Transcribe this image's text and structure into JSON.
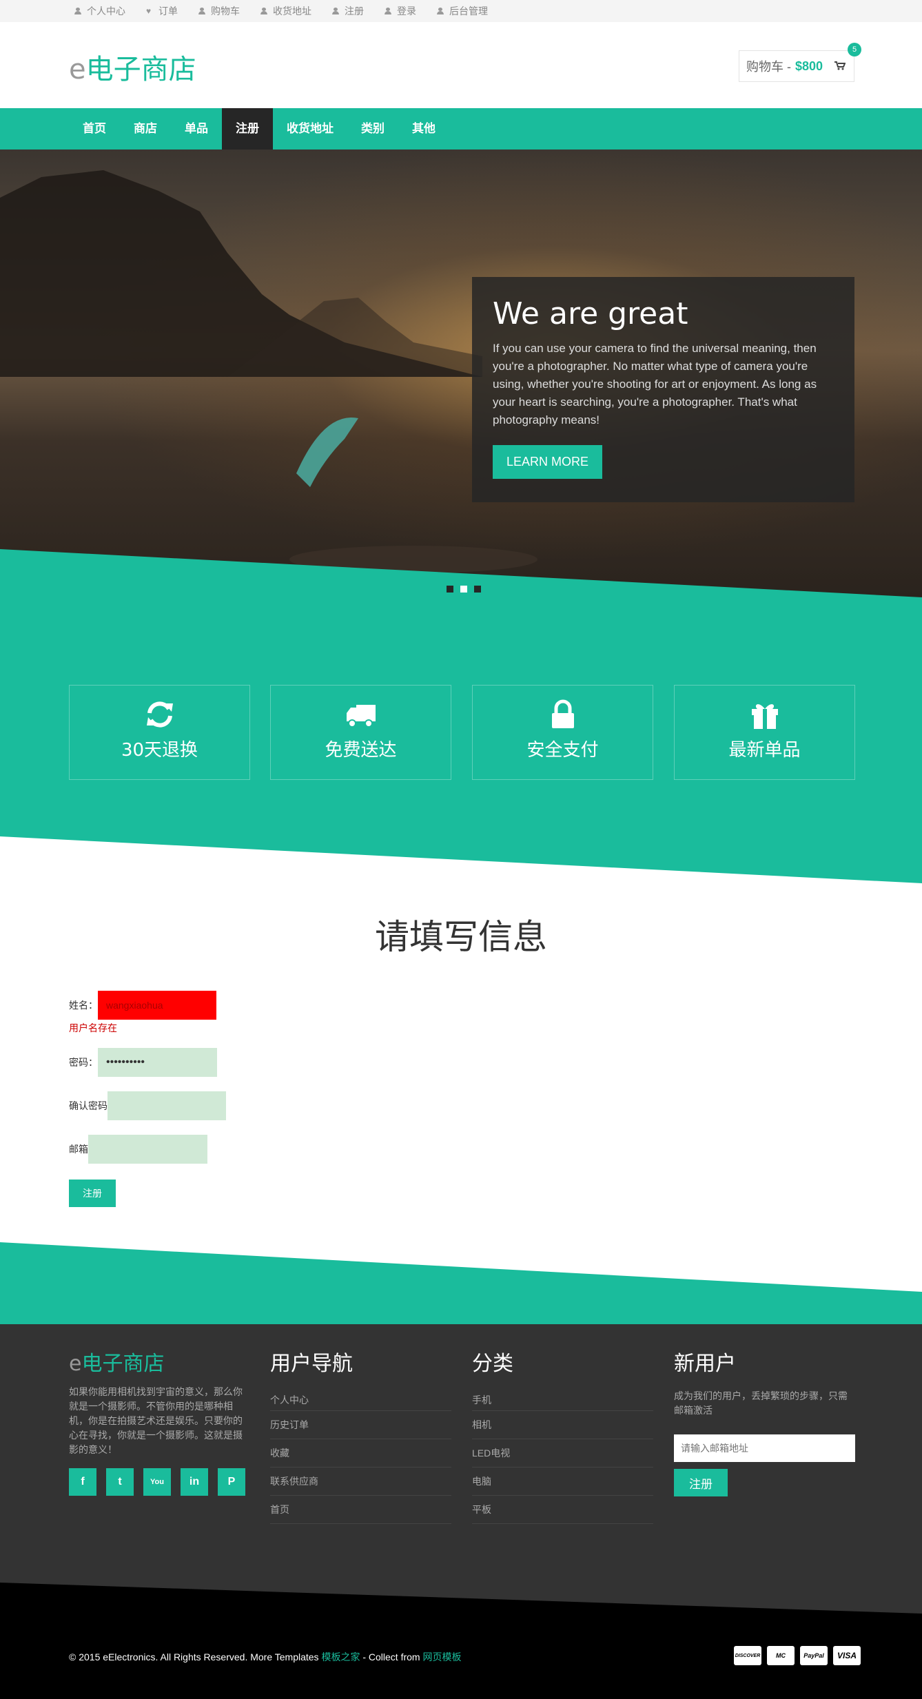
{
  "topbar": {
    "items": [
      "个人中心",
      "订单",
      "购物车",
      "收货地址",
      "注册",
      "登录",
      "后台管理"
    ]
  },
  "header": {
    "logo_e": "e",
    "logo_text": "电子商店",
    "cart_label": "购物车 -",
    "cart_amount": "$800",
    "cart_badge": "5"
  },
  "nav": {
    "items": [
      "首页",
      "商店",
      "单品",
      "注册",
      "收货地址",
      "类别",
      "其他"
    ],
    "active": "注册"
  },
  "hero": {
    "title": "We are great",
    "text": "If you can use your camera to find the universal meaning, then you're a photographer. No matter what type of camera you're using, whether you're shooting for art or enjoyment. As long as your heart is searching, you're a photographer. That's what photography means!",
    "button": "LEARN MORE",
    "slides": 3,
    "active_slide": 2
  },
  "features": [
    "30天退换",
    "免费送达",
    "安全支付",
    "最新单品"
  ],
  "form": {
    "title": "请填写信息",
    "name_label": "姓名：",
    "name_value": "wangxiaohua",
    "name_error": "用户名存在",
    "password_label": "密码：",
    "password_value": "••••••••••",
    "confirm_label": "确认密码",
    "email_label": "邮箱",
    "submit": "注册"
  },
  "footer": {
    "logo_e": "e",
    "logo_text": "电子商店",
    "desc": "如果你能用相机找到宇宙的意义，那么你就是一个摄影师。不管你用的是哪种相机，你是在拍摄艺术还是娱乐。只要你的心在寻找，你就是一个摄影师。这就是摄影的意义！",
    "socials": [
      "f",
      "t",
      "You",
      "in",
      "P"
    ],
    "nav_title": "用户导航",
    "nav_items": [
      "个人中心",
      "历史订单",
      "收藏",
      "联系供应商",
      "首页"
    ],
    "cat_title": "分类",
    "cat_items": [
      "手机",
      "相机",
      "LED电视",
      "电脑",
      "平板"
    ],
    "new_title": "新用户",
    "new_desc": "成为我们的用户，丢掉繁琐的步骤，只需邮箱激活",
    "email_placeholder": "请输入邮箱地址",
    "subscribe": "注册"
  },
  "bottom": {
    "copy_text": "© 2015 eElectronics. All Rights Reserved. More Templates ",
    "link1": "模板之家",
    "mid": " - Collect from ",
    "link2": "网页模板",
    "cards": [
      "DISCOVER",
      "MC",
      "PayPal",
      "VISA"
    ]
  },
  "colors": {
    "accent": "#1abc9c",
    "dark": "#262626",
    "footer": "#333333",
    "error": "#ff0000",
    "field": "#d0e9d6"
  }
}
